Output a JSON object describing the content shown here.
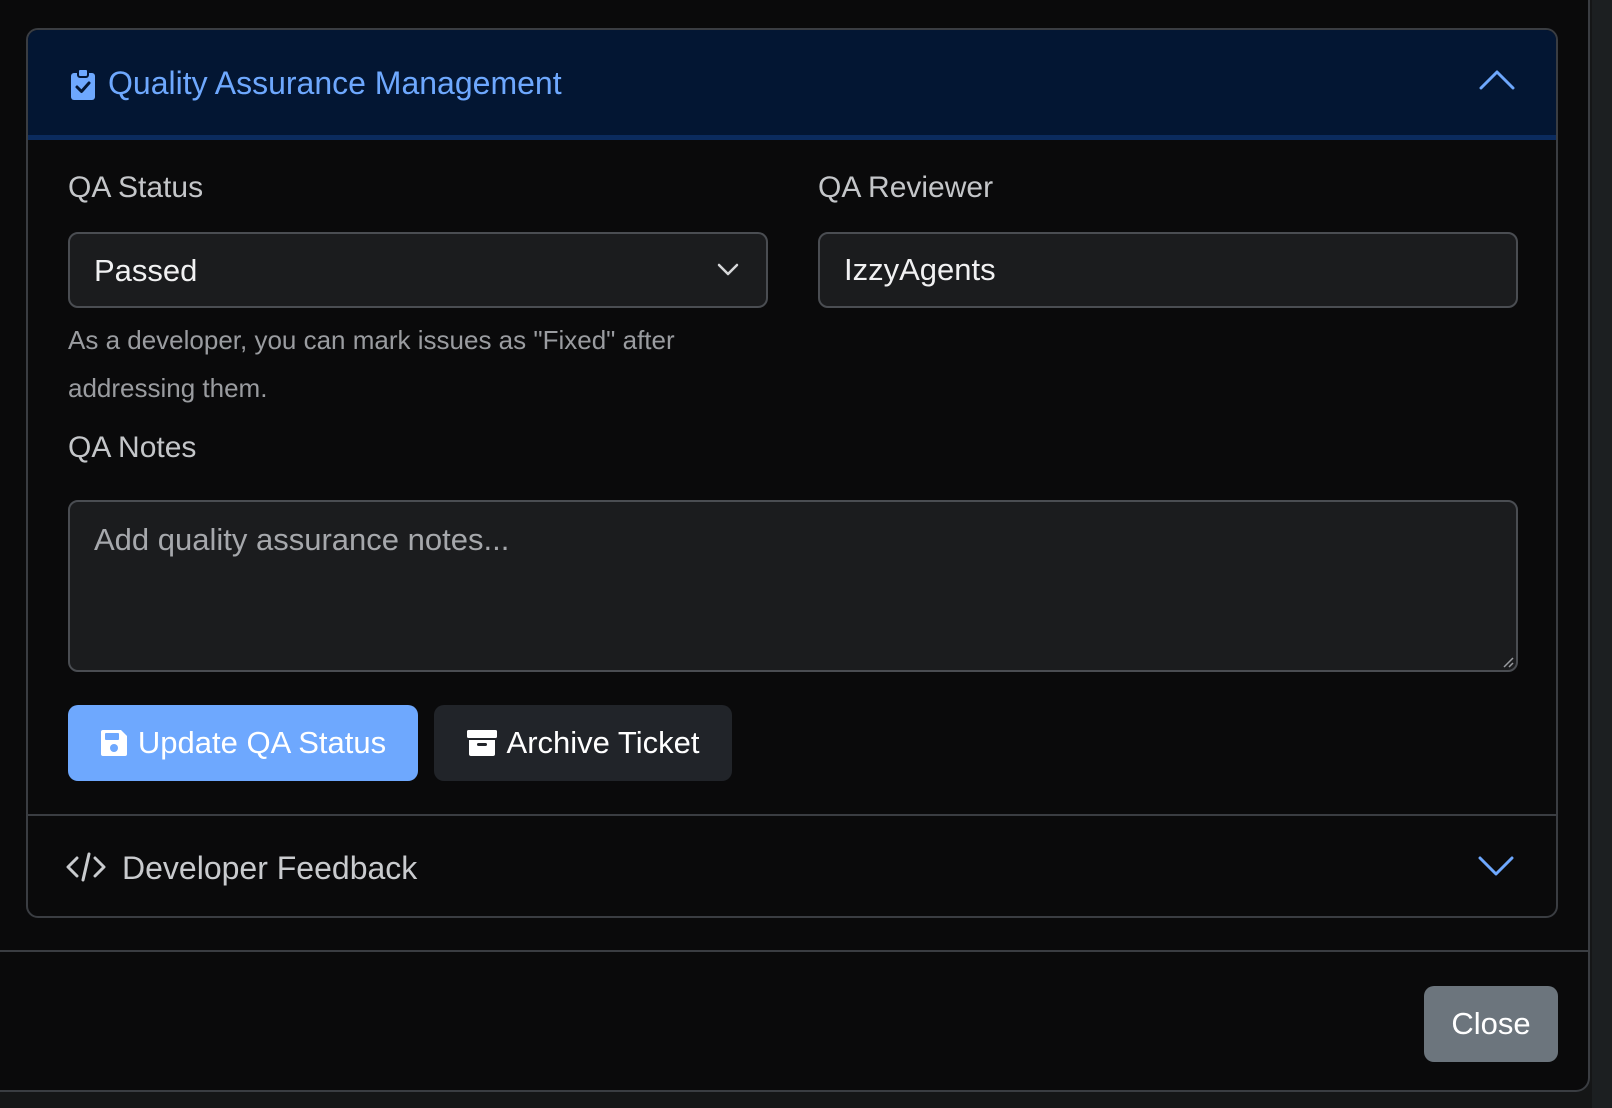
{
  "qa_section": {
    "title": "Quality Assurance Management",
    "icon": "clipboard-check-icon",
    "expanded": true,
    "status": {
      "label": "QA Status",
      "selected": "Passed",
      "help": "As a developer, you can mark issues as \"Fixed\" after addressing them."
    },
    "reviewer": {
      "label": "QA Reviewer",
      "value": "IzzyAgents"
    },
    "notes": {
      "label": "QA Notes",
      "placeholder": "Add quality assurance notes..."
    },
    "update_button": {
      "label": "Update QA Status",
      "icon": "floppy-disk-icon"
    },
    "archive_button": {
      "label": "Archive Ticket",
      "icon": "archive-box-icon"
    }
  },
  "dev_section": {
    "title": "Developer Feedback",
    "icon": "code-icon",
    "expanded": false
  },
  "footer": {
    "close_label": "Close"
  },
  "colors": {
    "accent": "#6ea8fe",
    "header_bg": "#031633",
    "secondary_button": "#6c757d",
    "dark_button": "#212429"
  }
}
